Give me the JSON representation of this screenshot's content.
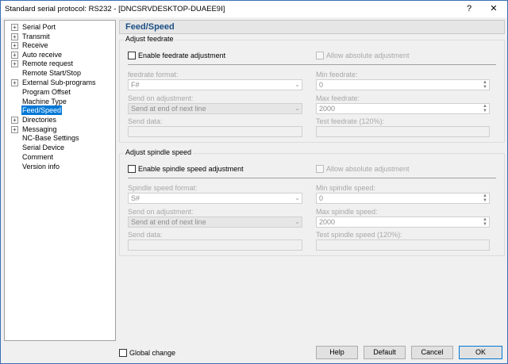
{
  "window": {
    "title": "Standard serial protocol: RS232 - [DNCSRVDESKTOP-DUAEE9I]",
    "help_glyph": "?",
    "close_glyph": "✕"
  },
  "tree": {
    "expand_glyph": "+",
    "items": [
      {
        "label": "Serial Port",
        "expandable": true
      },
      {
        "label": "Transmit",
        "expandable": true
      },
      {
        "label": "Receive",
        "expandable": true
      },
      {
        "label": "Auto receive",
        "expandable": true
      },
      {
        "label": "Remote request",
        "expandable": true
      },
      {
        "label": "Remote Start/Stop",
        "expandable": false
      },
      {
        "label": "External Sub-programs",
        "expandable": true
      },
      {
        "label": "Program Offset",
        "expandable": false
      },
      {
        "label": "Machine Type",
        "expandable": false
      },
      {
        "label": "Feed/Speed",
        "expandable": false,
        "selected": true
      },
      {
        "label": "Directories",
        "expandable": true
      },
      {
        "label": "Messaging",
        "expandable": true
      },
      {
        "label": "NC-Base Settings",
        "expandable": false
      },
      {
        "label": "Serial Device",
        "expandable": false
      },
      {
        "label": "Comment",
        "expandable": false
      },
      {
        "label": "Version info",
        "expandable": false
      }
    ]
  },
  "panel": {
    "title": "Feed/Speed"
  },
  "feed": {
    "group_title": "Adjust feedrate",
    "enable_label": "Enable feedrate adjustment",
    "allow_abs_label": "Allow absolute adjustment",
    "format_label": "feedrate format:",
    "format_value": "F#",
    "send_on_label": "Send on adjustment:",
    "send_on_value": "Send at end of next line",
    "send_data_label": "Send data:",
    "min_label": "Min feedrate:",
    "min_value": "0",
    "max_label": "Max feedrate:",
    "max_value": "2000",
    "test_label": "Test feedrate (120%):"
  },
  "spindle": {
    "group_title": "Adjust spindle speed",
    "enable_label": "Enable spindle speed adjustment",
    "allow_abs_label": "Allow absolute adjustment",
    "format_label": "Spindle speed format:",
    "format_value": "S#",
    "send_on_label": "Send on adjustment:",
    "send_on_value": "Send at end of next line",
    "send_data_label": "Send data:",
    "min_label": "Min spindle speed:",
    "min_value": "0",
    "max_label": "Max spindle speed:",
    "max_value": "2000",
    "test_label": "Test spindle speed (120%):"
  },
  "footer": {
    "global_change_label": "Global change",
    "help": "Help",
    "default": "Default",
    "cancel": "Cancel",
    "ok": "OK"
  },
  "glyphs": {
    "dropdown": "⌄",
    "spin_up": "▲",
    "spin_down": "▼"
  }
}
